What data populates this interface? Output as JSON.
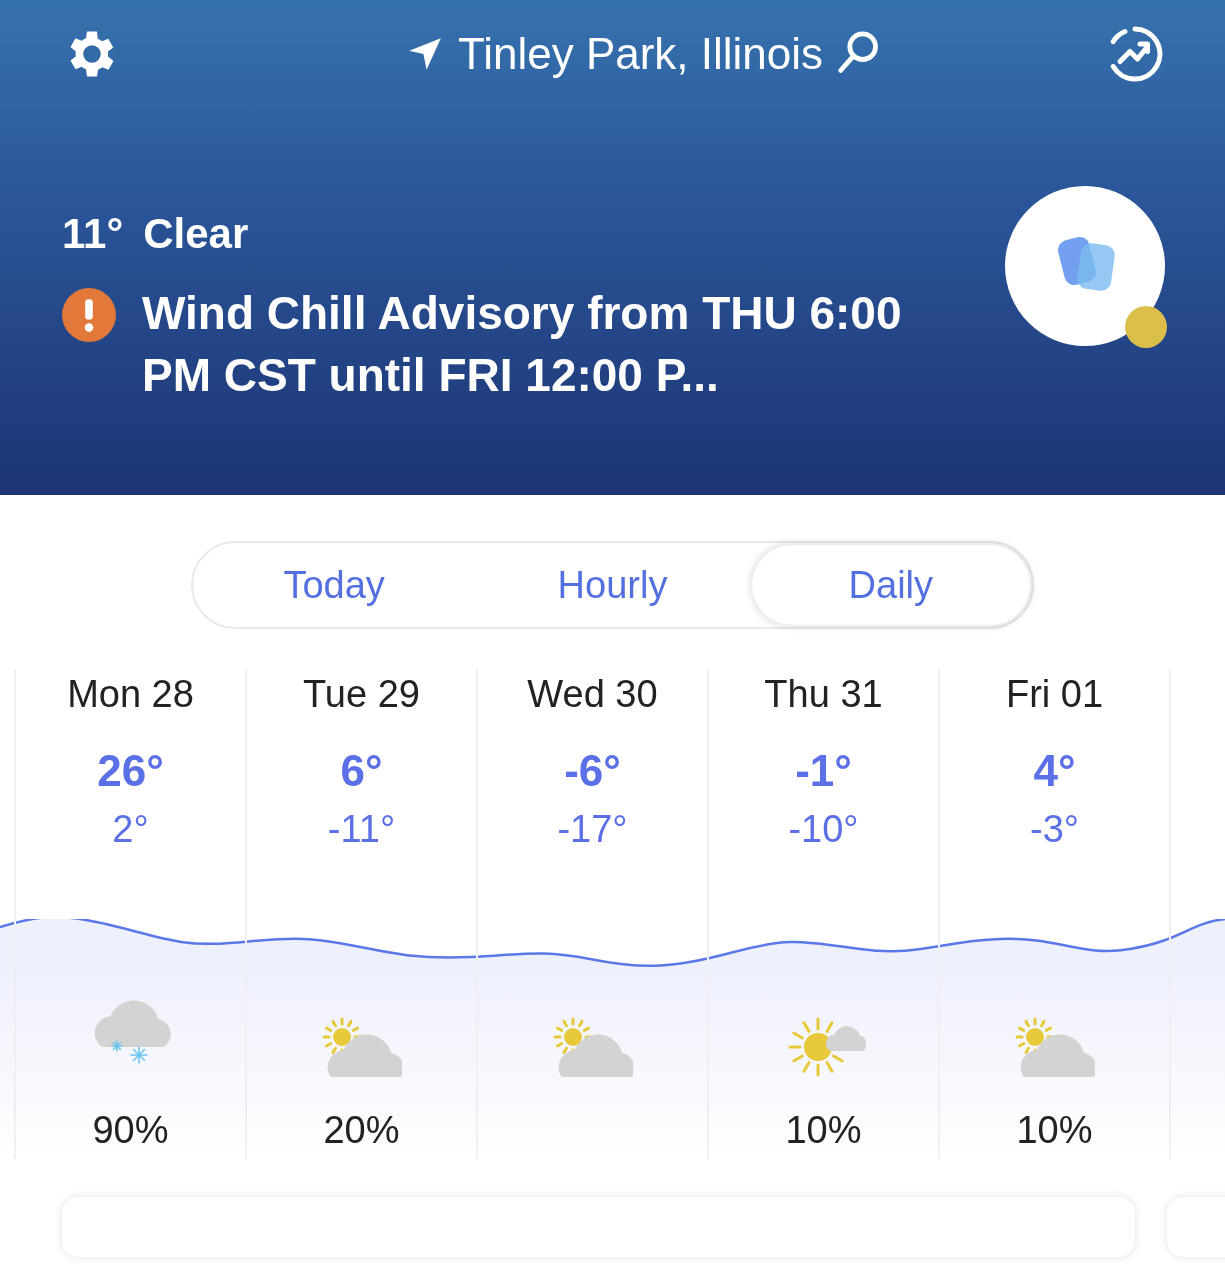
{
  "header": {
    "location": "Tinley Park, Illinois",
    "temperature": "11°",
    "condition": "Clear",
    "alert": "Wind Chill Advisory from THU 6:00 PM CST until FRI 12:00 P..."
  },
  "tabs": [
    {
      "label": "Today",
      "selected": false
    },
    {
      "label": "Hourly",
      "selected": false
    },
    {
      "label": "Daily",
      "selected": true
    }
  ],
  "days": [
    {
      "day": "Mon 28",
      "high": "26°",
      "low": "2°",
      "kind": "snow",
      "precip": "90%"
    },
    {
      "day": "Tue 29",
      "high": "6°",
      "low": "-11°",
      "kind": "partly-sunny",
      "precip": "20%"
    },
    {
      "day": "Wed 30",
      "high": "-6°",
      "low": "-17°",
      "kind": "partly-sunny"
    },
    {
      "day": "Thu 31",
      "high": "-1°",
      "low": "-10°",
      "kind": "sun-cloud",
      "precip": "10%"
    },
    {
      "day": "Fri 01",
      "high": "4°",
      "low": "-3°",
      "kind": "partly-sunny",
      "precip": "10%"
    }
  ]
}
